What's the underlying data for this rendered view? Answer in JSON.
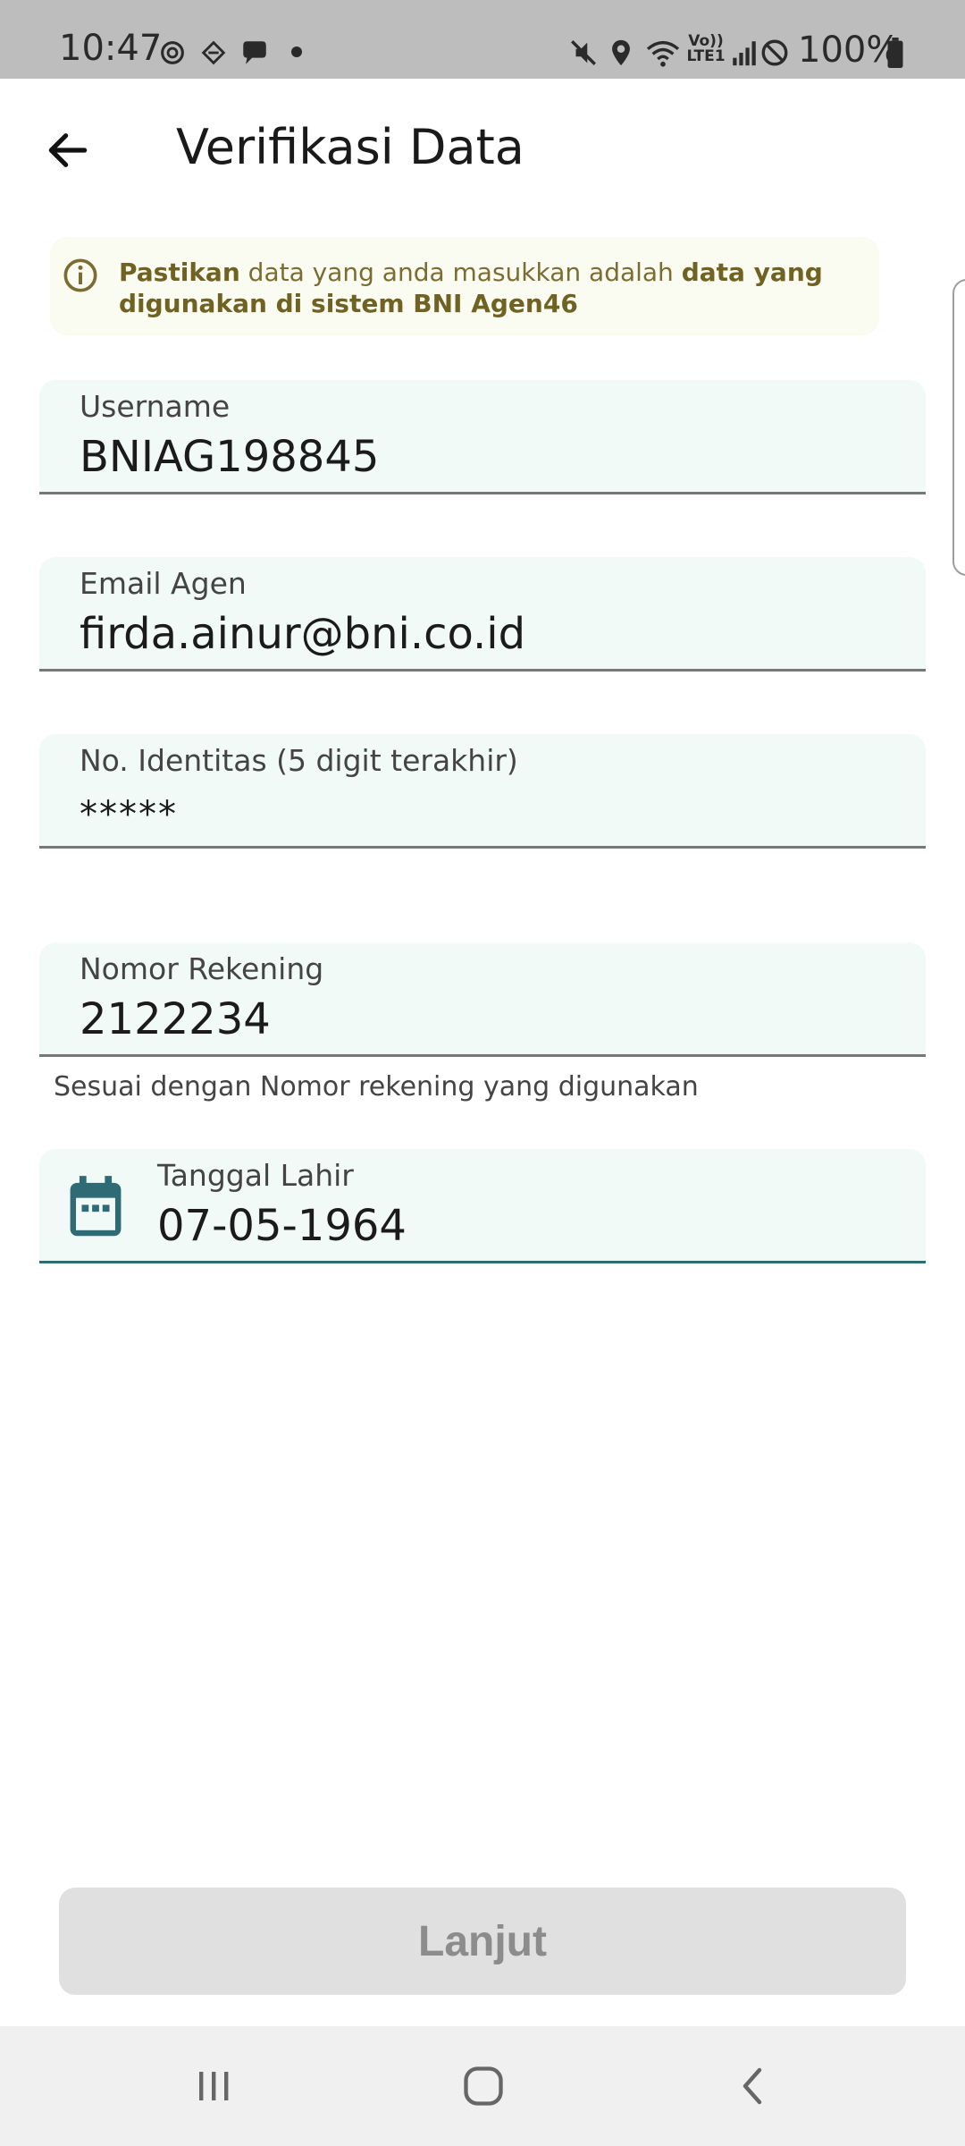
{
  "status_bar": {
    "time": "10:47",
    "network_label_top": "Vo))",
    "network_label_bottom": "LTE1",
    "battery_text": "100%"
  },
  "header": {
    "title": "Verifikasi Data",
    "back_icon": "arrow-left-icon"
  },
  "info": {
    "icon": "info-circle-icon",
    "bold_start": "Pastikan",
    "text_middle": " data yang anda masukkan adalah ",
    "bold_end": "data yang digunakan di sistem BNI Agen46"
  },
  "form": {
    "username": {
      "label": "Username",
      "value": "BNIAG198845"
    },
    "email": {
      "label": "Email Agen",
      "value": "firda.ainur@bni.co.id"
    },
    "identity": {
      "label": "No. Identitas (5 digit terakhir)",
      "value": "*****"
    },
    "account": {
      "label": "Nomor Rekening",
      "value": "2122234",
      "helper": "Sesuai dengan Nomor rekening yang digunakan"
    },
    "birthdate": {
      "label": "Tanggal Lahir",
      "value": "07-05-1964",
      "icon": "calendar-icon"
    }
  },
  "actions": {
    "next_label": "Lanjut"
  },
  "nav": {
    "recents_icon": "recents-icon",
    "home_icon": "home-icon",
    "back_icon": "back-chevron-icon"
  },
  "colors": {
    "field_bg": "#f1faf7",
    "focus_underline": "#2e6b74",
    "info_text": "#7a6c33",
    "button_disabled_bg": "#e0e0e0"
  }
}
